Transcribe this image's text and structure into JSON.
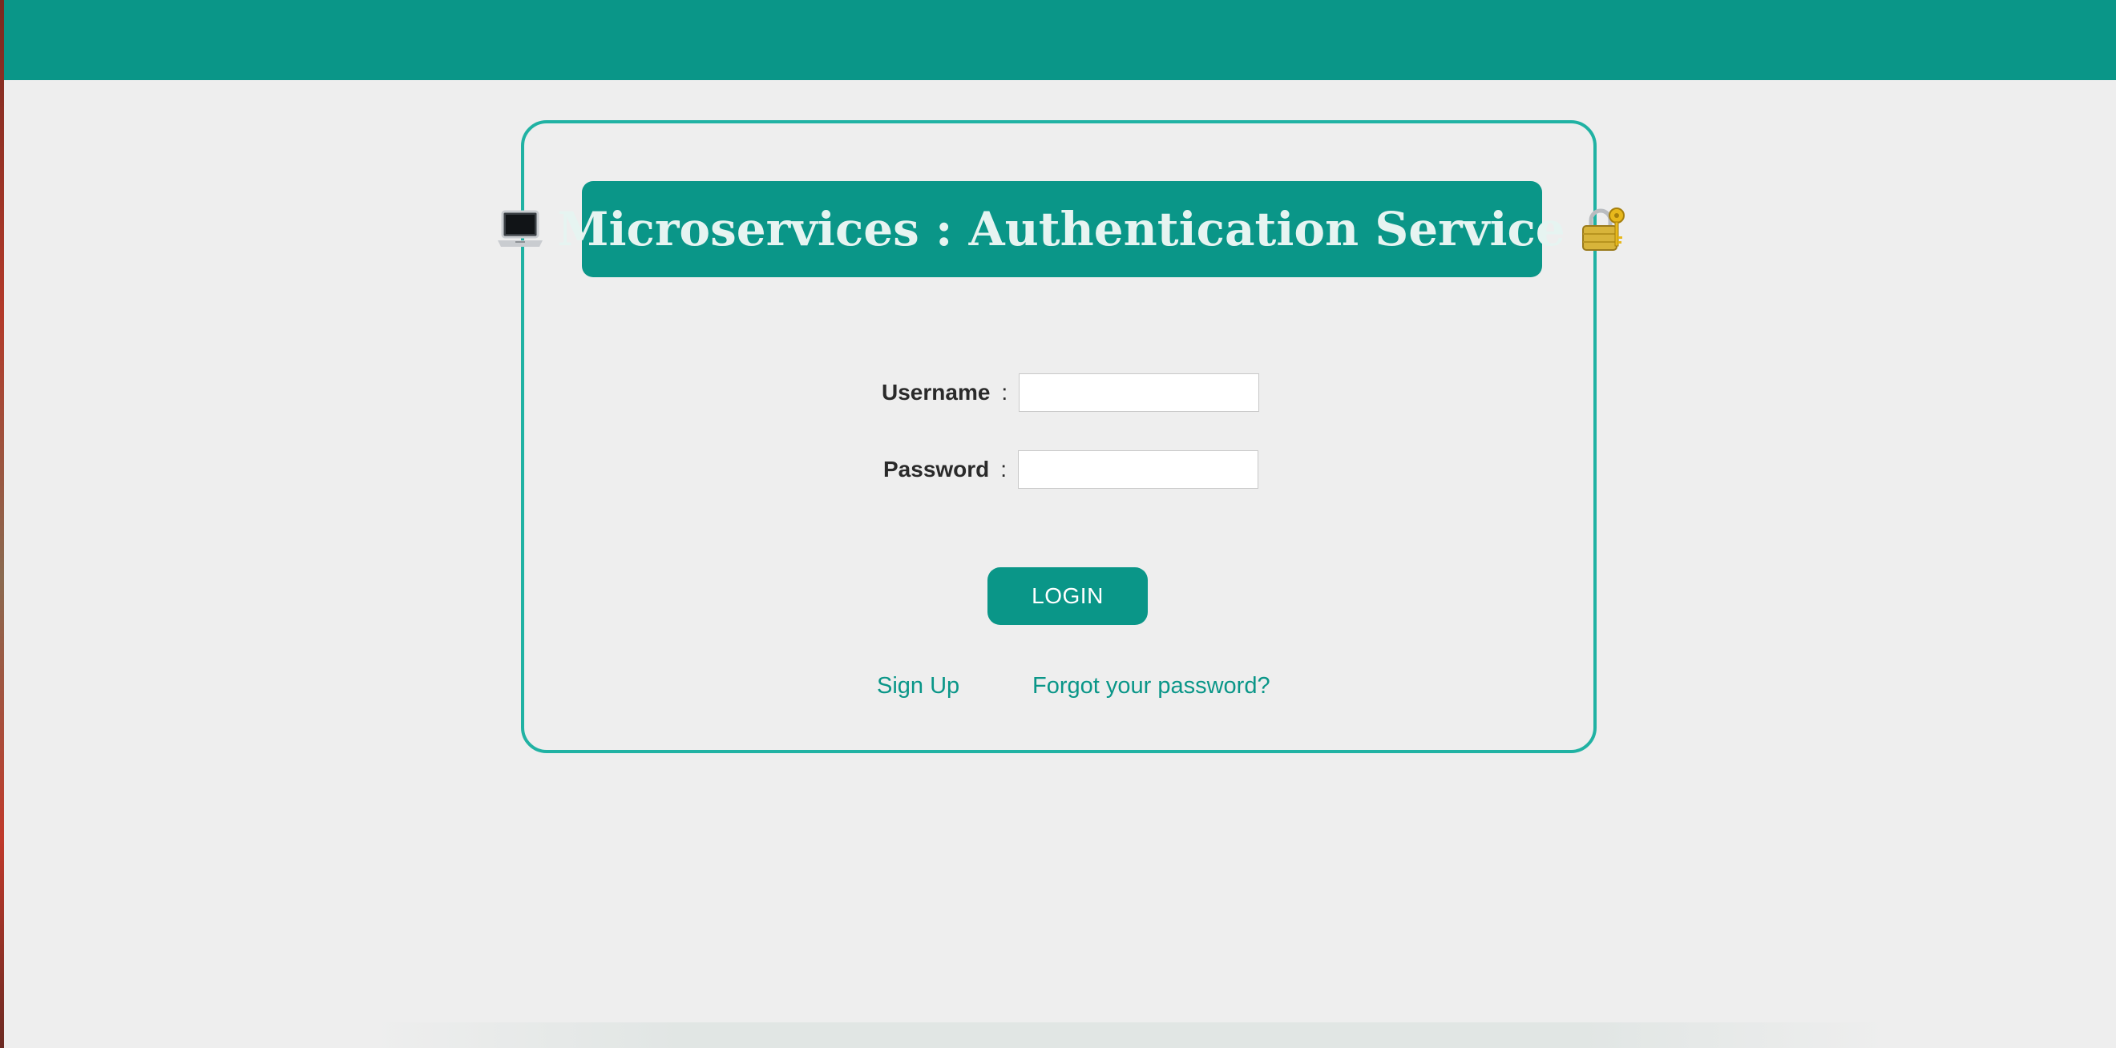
{
  "header": {
    "title": "Microservices : Authentication Service",
    "left_icon": "laptop-icon",
    "right_icon": "lock-with-key-icon"
  },
  "form": {
    "username_label": "Username",
    "password_label": "Password",
    "separator": ":",
    "username_value": "",
    "password_value": "",
    "login_label": "LOGIN"
  },
  "links": {
    "sign_up": "Sign Up",
    "forgot_password": "Forgot your password?"
  },
  "colors": {
    "brand": "#0a9688",
    "card_border": "#20b2a3",
    "background": "#eeeeee",
    "title_text": "#e6f4f1"
  }
}
